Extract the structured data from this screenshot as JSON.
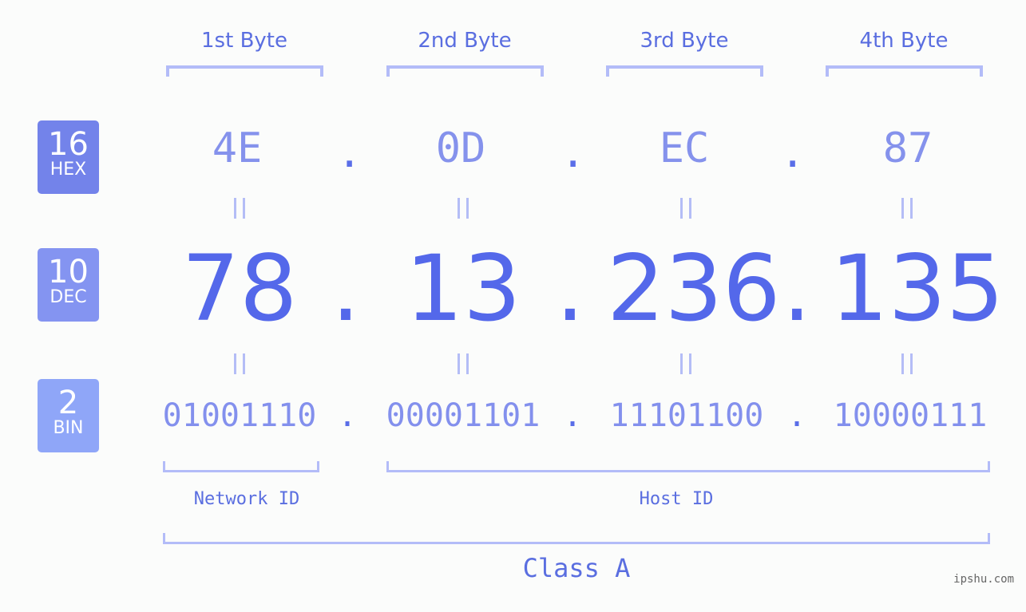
{
  "badges": {
    "hex": {
      "base": "16",
      "label": "HEX"
    },
    "dec": {
      "base": "10",
      "label": "DEC"
    },
    "bin": {
      "base": "2",
      "label": "BIN"
    }
  },
  "byte_labels": [
    "1st Byte",
    "2nd Byte",
    "3rd Byte",
    "4th Byte"
  ],
  "hex": [
    "4E",
    "0D",
    "EC",
    "87"
  ],
  "dec": [
    "78",
    "13",
    "236",
    "135"
  ],
  "bin": [
    "01001110",
    "00001101",
    "11101100",
    "10000111"
  ],
  "separator": ".",
  "equals_sign": "=",
  "network_id_label": "Network ID",
  "host_id_label": "Host ID",
  "class_label": "Class A",
  "watermark": "ipshu.com",
  "colors": {
    "primary": "#5468ea",
    "hex_text": "#8592ec",
    "bracket": "#b3bcf8",
    "badge_hex": "#7383ea",
    "badge_dec": "#8494f1",
    "badge_bin": "#8fa6f8"
  }
}
